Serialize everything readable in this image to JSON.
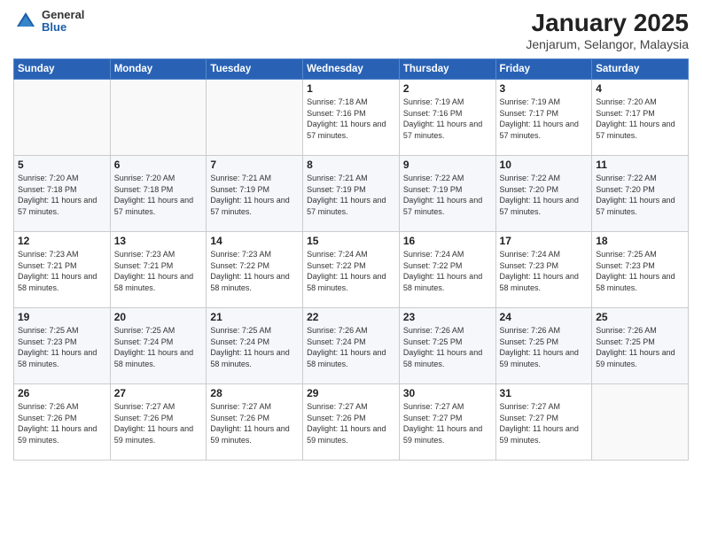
{
  "header": {
    "logo_general": "General",
    "logo_blue": "Blue",
    "month_title": "January 2025",
    "location": "Jenjarum, Selangor, Malaysia"
  },
  "days_of_week": [
    "Sunday",
    "Monday",
    "Tuesday",
    "Wednesday",
    "Thursday",
    "Friday",
    "Saturday"
  ],
  "weeks": [
    [
      {
        "day": "",
        "sunrise": "",
        "sunset": "",
        "daylight": ""
      },
      {
        "day": "",
        "sunrise": "",
        "sunset": "",
        "daylight": ""
      },
      {
        "day": "",
        "sunrise": "",
        "sunset": "",
        "daylight": ""
      },
      {
        "day": "1",
        "sunrise": "Sunrise: 7:18 AM",
        "sunset": "Sunset: 7:16 PM",
        "daylight": "Daylight: 11 hours and 57 minutes."
      },
      {
        "day": "2",
        "sunrise": "Sunrise: 7:19 AM",
        "sunset": "Sunset: 7:16 PM",
        "daylight": "Daylight: 11 hours and 57 minutes."
      },
      {
        "day": "3",
        "sunrise": "Sunrise: 7:19 AM",
        "sunset": "Sunset: 7:17 PM",
        "daylight": "Daylight: 11 hours and 57 minutes."
      },
      {
        "day": "4",
        "sunrise": "Sunrise: 7:20 AM",
        "sunset": "Sunset: 7:17 PM",
        "daylight": "Daylight: 11 hours and 57 minutes."
      }
    ],
    [
      {
        "day": "5",
        "sunrise": "Sunrise: 7:20 AM",
        "sunset": "Sunset: 7:18 PM",
        "daylight": "Daylight: 11 hours and 57 minutes."
      },
      {
        "day": "6",
        "sunrise": "Sunrise: 7:20 AM",
        "sunset": "Sunset: 7:18 PM",
        "daylight": "Daylight: 11 hours and 57 minutes."
      },
      {
        "day": "7",
        "sunrise": "Sunrise: 7:21 AM",
        "sunset": "Sunset: 7:19 PM",
        "daylight": "Daylight: 11 hours and 57 minutes."
      },
      {
        "day": "8",
        "sunrise": "Sunrise: 7:21 AM",
        "sunset": "Sunset: 7:19 PM",
        "daylight": "Daylight: 11 hours and 57 minutes."
      },
      {
        "day": "9",
        "sunrise": "Sunrise: 7:22 AM",
        "sunset": "Sunset: 7:19 PM",
        "daylight": "Daylight: 11 hours and 57 minutes."
      },
      {
        "day": "10",
        "sunrise": "Sunrise: 7:22 AM",
        "sunset": "Sunset: 7:20 PM",
        "daylight": "Daylight: 11 hours and 57 minutes."
      },
      {
        "day": "11",
        "sunrise": "Sunrise: 7:22 AM",
        "sunset": "Sunset: 7:20 PM",
        "daylight": "Daylight: 11 hours and 57 minutes."
      }
    ],
    [
      {
        "day": "12",
        "sunrise": "Sunrise: 7:23 AM",
        "sunset": "Sunset: 7:21 PM",
        "daylight": "Daylight: 11 hours and 58 minutes."
      },
      {
        "day": "13",
        "sunrise": "Sunrise: 7:23 AM",
        "sunset": "Sunset: 7:21 PM",
        "daylight": "Daylight: 11 hours and 58 minutes."
      },
      {
        "day": "14",
        "sunrise": "Sunrise: 7:23 AM",
        "sunset": "Sunset: 7:22 PM",
        "daylight": "Daylight: 11 hours and 58 minutes."
      },
      {
        "day": "15",
        "sunrise": "Sunrise: 7:24 AM",
        "sunset": "Sunset: 7:22 PM",
        "daylight": "Daylight: 11 hours and 58 minutes."
      },
      {
        "day": "16",
        "sunrise": "Sunrise: 7:24 AM",
        "sunset": "Sunset: 7:22 PM",
        "daylight": "Daylight: 11 hours and 58 minutes."
      },
      {
        "day": "17",
        "sunrise": "Sunrise: 7:24 AM",
        "sunset": "Sunset: 7:23 PM",
        "daylight": "Daylight: 11 hours and 58 minutes."
      },
      {
        "day": "18",
        "sunrise": "Sunrise: 7:25 AM",
        "sunset": "Sunset: 7:23 PM",
        "daylight": "Daylight: 11 hours and 58 minutes."
      }
    ],
    [
      {
        "day": "19",
        "sunrise": "Sunrise: 7:25 AM",
        "sunset": "Sunset: 7:23 PM",
        "daylight": "Daylight: 11 hours and 58 minutes."
      },
      {
        "day": "20",
        "sunrise": "Sunrise: 7:25 AM",
        "sunset": "Sunset: 7:24 PM",
        "daylight": "Daylight: 11 hours and 58 minutes."
      },
      {
        "day": "21",
        "sunrise": "Sunrise: 7:25 AM",
        "sunset": "Sunset: 7:24 PM",
        "daylight": "Daylight: 11 hours and 58 minutes."
      },
      {
        "day": "22",
        "sunrise": "Sunrise: 7:26 AM",
        "sunset": "Sunset: 7:24 PM",
        "daylight": "Daylight: 11 hours and 58 minutes."
      },
      {
        "day": "23",
        "sunrise": "Sunrise: 7:26 AM",
        "sunset": "Sunset: 7:25 PM",
        "daylight": "Daylight: 11 hours and 58 minutes."
      },
      {
        "day": "24",
        "sunrise": "Sunrise: 7:26 AM",
        "sunset": "Sunset: 7:25 PM",
        "daylight": "Daylight: 11 hours and 59 minutes."
      },
      {
        "day": "25",
        "sunrise": "Sunrise: 7:26 AM",
        "sunset": "Sunset: 7:25 PM",
        "daylight": "Daylight: 11 hours and 59 minutes."
      }
    ],
    [
      {
        "day": "26",
        "sunrise": "Sunrise: 7:26 AM",
        "sunset": "Sunset: 7:26 PM",
        "daylight": "Daylight: 11 hours and 59 minutes."
      },
      {
        "day": "27",
        "sunrise": "Sunrise: 7:27 AM",
        "sunset": "Sunset: 7:26 PM",
        "daylight": "Daylight: 11 hours and 59 minutes."
      },
      {
        "day": "28",
        "sunrise": "Sunrise: 7:27 AM",
        "sunset": "Sunset: 7:26 PM",
        "daylight": "Daylight: 11 hours and 59 minutes."
      },
      {
        "day": "29",
        "sunrise": "Sunrise: 7:27 AM",
        "sunset": "Sunset: 7:26 PM",
        "daylight": "Daylight: 11 hours and 59 minutes."
      },
      {
        "day": "30",
        "sunrise": "Sunrise: 7:27 AM",
        "sunset": "Sunset: 7:27 PM",
        "daylight": "Daylight: 11 hours and 59 minutes."
      },
      {
        "day": "31",
        "sunrise": "Sunrise: 7:27 AM",
        "sunset": "Sunset: 7:27 PM",
        "daylight": "Daylight: 11 hours and 59 minutes."
      },
      {
        "day": "",
        "sunrise": "",
        "sunset": "",
        "daylight": ""
      }
    ]
  ]
}
